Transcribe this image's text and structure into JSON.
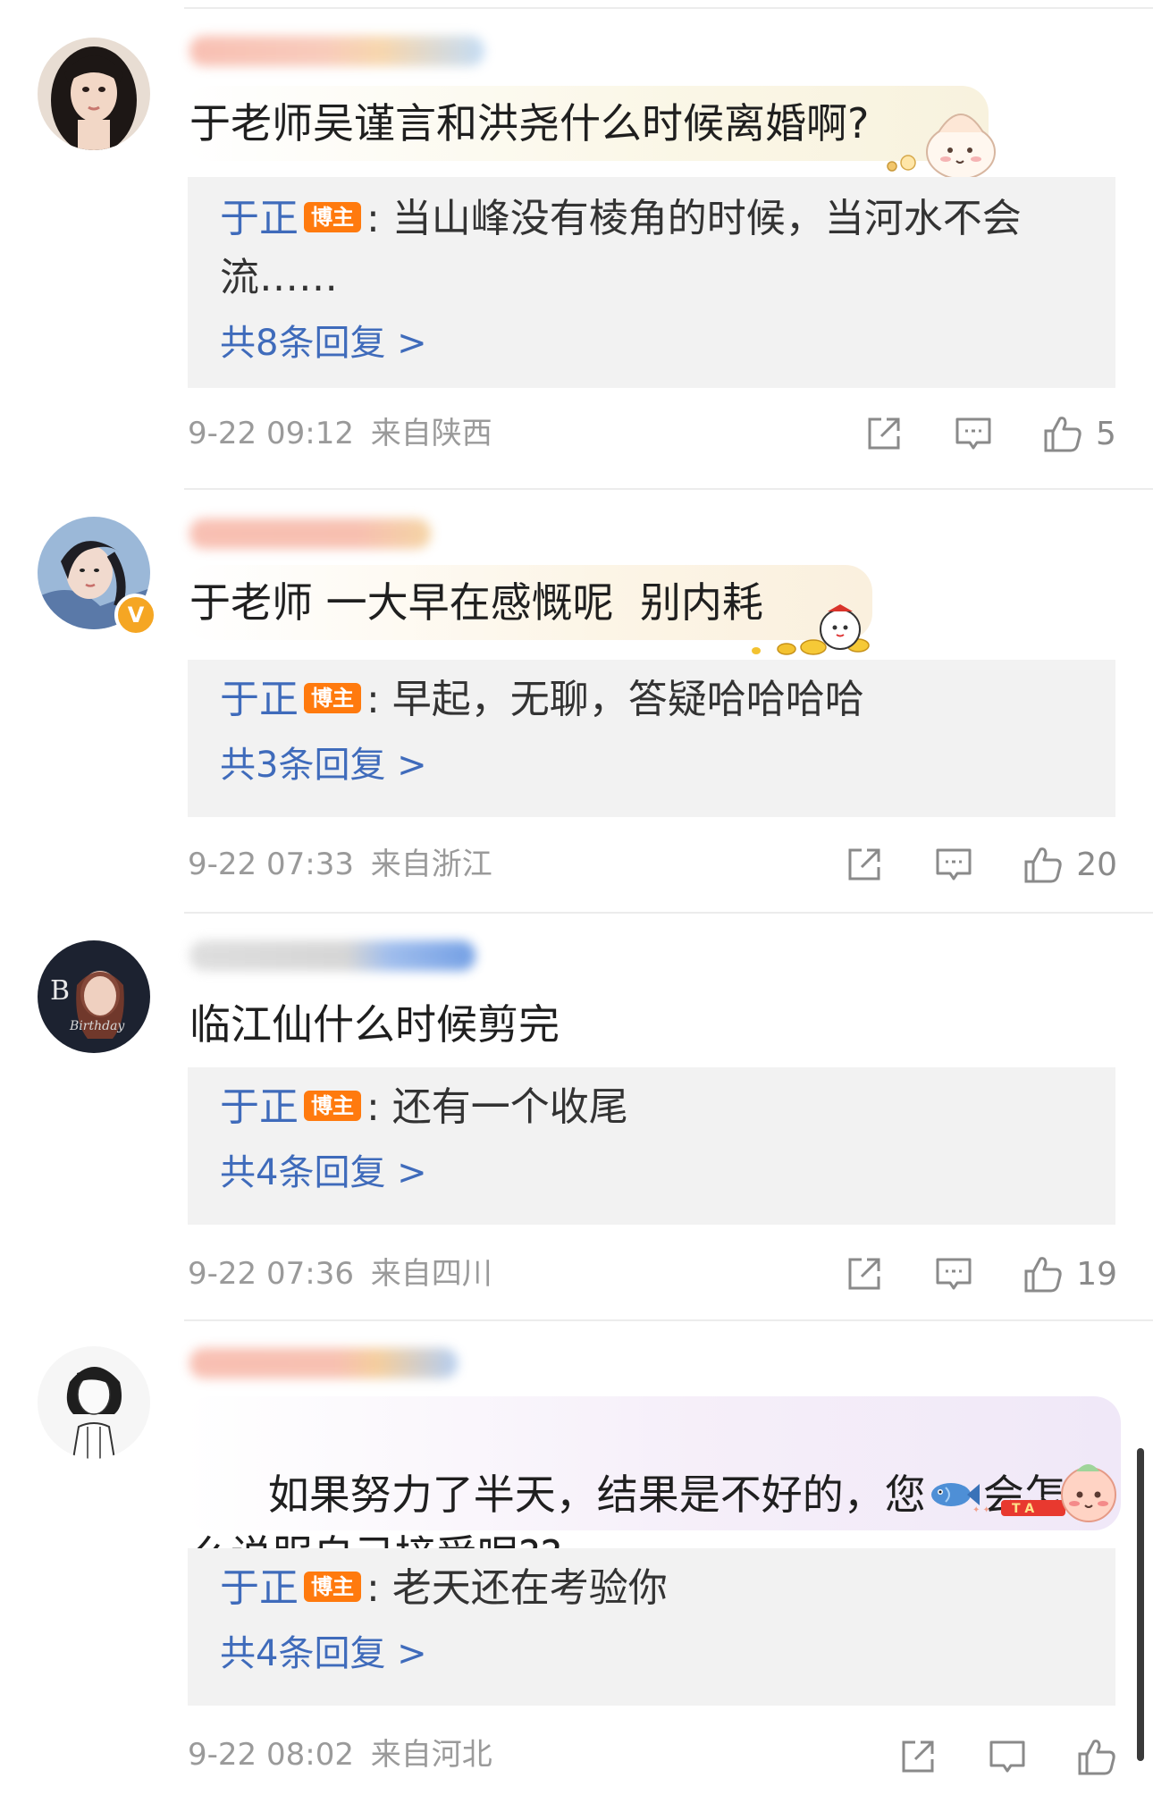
{
  "comments": [
    {
      "text": "于老师吴谨言和洪尧什么时候离婚啊?",
      "reply_author": "于正",
      "reply_badge": "博主",
      "reply_text": ": 当山峰没有棱角的时候，当河水不会流……",
      "reply_count": "共8条回复 >",
      "date": "9-22 09:12",
      "location": "来自陕西",
      "likes": "5"
    },
    {
      "text": "于老师 一大早在感慨呢  别内耗",
      "reply_author": "于正",
      "reply_badge": "博主",
      "reply_text": ": 早起，无聊，答疑哈哈哈哈",
      "reply_count": "共3条回复 >",
      "date": "9-22 07:33",
      "location": "来自浙江",
      "likes": "20"
    },
    {
      "text": "临江仙什么时候剪完",
      "reply_author": "于正",
      "reply_badge": "博主",
      "reply_text": ": 还有一个收尾",
      "reply_count": "共4条回复 >",
      "date": "9-22 07:36",
      "location": "来自四川",
      "likes": "19"
    },
    {
      "text_before": "如果努力了半天，结果是不好的，您",
      "text_after": "会怎么说服自己接受呢??",
      "reply_author": "于正",
      "reply_badge": "博主",
      "reply_text": ": 老天还在考验你",
      "reply_count": "共4条回复 >",
      "date": "9-22 08:02",
      "location": "来自河北"
    }
  ],
  "icons": {
    "verified": "V",
    "fish": "fish-emoji-icon",
    "share": "share-icon",
    "comment": "comment-icon",
    "like": "thumbs-up-icon"
  },
  "colors": {
    "link_blue": "#3f6bbb",
    "badge_orange": "#ff7a0e",
    "reply_bg": "#f2f2f2",
    "meta_gray": "#9a9a9a"
  }
}
